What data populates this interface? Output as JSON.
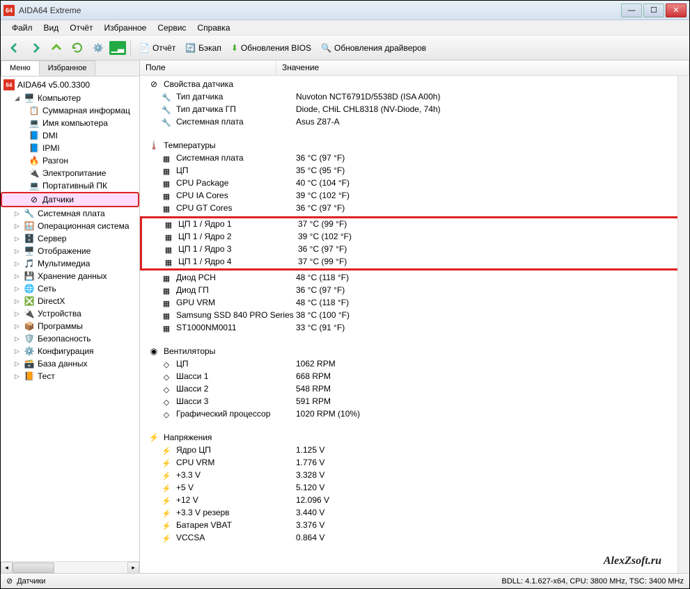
{
  "window": {
    "title": "AIDA64 Extreme"
  },
  "menu": [
    "Файл",
    "Вид",
    "Отчёт",
    "Избранное",
    "Сервис",
    "Справка"
  ],
  "toolbar": {
    "report": "Отчёт",
    "backup": "Бэкап",
    "bios_update": "Обновления BIOS",
    "driver_update": "Обновления драйверов"
  },
  "tabs": {
    "menu": "Меню",
    "fav": "Избранное"
  },
  "tree": {
    "root": "AIDA64 v5.00.3300",
    "computer": "Компьютер",
    "computer_children": [
      "Суммарная информац",
      "Имя компьютера",
      "DMI",
      "IPMI",
      "Разгон",
      "Электропитание",
      "Портативный ПК",
      "Датчики"
    ],
    "siblings": [
      "Системная плата",
      "Операционная система",
      "Сервер",
      "Отображение",
      "Мультимедиа",
      "Хранение данных",
      "Сеть",
      "DirectX",
      "Устройства",
      "Программы",
      "Безопасность",
      "Конфигурация",
      "База данных",
      "Тест"
    ]
  },
  "columns": {
    "field": "Поле",
    "value": "Значение"
  },
  "sections": {
    "sensor_props": {
      "title": "Свойства датчика",
      "rows": [
        {
          "label": "Тип датчика",
          "value": "Nuvoton NCT6791D/5538D  (ISA A00h)"
        },
        {
          "label": "Тип датчика ГП",
          "value": "Diode, CHiL CHL8318  (NV-Diode, 74h)"
        },
        {
          "label": "Системная плата",
          "value": "Asus Z87-A"
        }
      ]
    },
    "temps": {
      "title": "Температуры",
      "rows_top": [
        {
          "label": "Системная плата",
          "value": "36 °C  (97 °F)"
        },
        {
          "label": "ЦП",
          "value": "35 °C  (95 °F)"
        },
        {
          "label": "CPU Package",
          "value": "40 °C  (104 °F)"
        },
        {
          "label": "CPU IA Cores",
          "value": "39 °C  (102 °F)"
        },
        {
          "label": "CPU GT Cores",
          "value": "36 °C  (97 °F)"
        }
      ],
      "rows_hl": [
        {
          "label": "ЦП 1 / Ядро 1",
          "value": "37 °C  (99 °F)"
        },
        {
          "label": "ЦП 1 / Ядро 2",
          "value": "39 °C  (102 °F)"
        },
        {
          "label": "ЦП 1 / Ядро 3",
          "value": "36 °C  (97 °F)"
        },
        {
          "label": "ЦП 1 / Ядро 4",
          "value": "37 °C  (99 °F)"
        }
      ],
      "rows_bot": [
        {
          "label": "Диод PCH",
          "value": "48 °C  (118 °F)"
        },
        {
          "label": "Диод ГП",
          "value": "36 °C  (97 °F)"
        },
        {
          "label": "GPU VRM",
          "value": "48 °C  (118 °F)"
        },
        {
          "label": "Samsung SSD 840 PRO Series",
          "value": "38 °C  (100 °F)"
        },
        {
          "label": "ST1000NM0011",
          "value": "33 °C  (91 °F)"
        }
      ]
    },
    "fans": {
      "title": "Вентиляторы",
      "rows": [
        {
          "label": "ЦП",
          "value": "1062 RPM"
        },
        {
          "label": "Шасси 1",
          "value": "668 RPM"
        },
        {
          "label": "Шасси 2",
          "value": "548 RPM"
        },
        {
          "label": "Шасси 3",
          "value": "591 RPM"
        },
        {
          "label": "Графический процессор",
          "value": "1020 RPM  (10%)"
        }
      ]
    },
    "volts": {
      "title": "Напряжения",
      "rows": [
        {
          "label": "Ядро ЦП",
          "value": "1.125 V"
        },
        {
          "label": "CPU VRM",
          "value": "1.776 V"
        },
        {
          "label": "+3.3 V",
          "value": "3.328 V"
        },
        {
          "label": "+5 V",
          "value": "5.120 V"
        },
        {
          "label": "+12 V",
          "value": "12.096 V"
        },
        {
          "label": "+3.3 V резерв",
          "value": "3.440 V"
        },
        {
          "label": "Батарея VBAT",
          "value": "3.376 V"
        },
        {
          "label": "VCCSA",
          "value": "0.864 V"
        }
      ]
    }
  },
  "statusbar": {
    "left": "Датчики",
    "right": "BDLL: 4.1.627-x64, CPU: 3800 MHz, TSC: 3400 MHz"
  },
  "watermark": "AlexZsoft.ru",
  "tree_icons": [
    "🖥️",
    "📋",
    "💻",
    "📘",
    "📘",
    "🔥",
    "🔌",
    "💻",
    "⊘"
  ],
  "sibling_icons": [
    "🔧",
    "🪟",
    "🗄️",
    "🖥️",
    "🎵",
    "💾",
    "🌐",
    "❎",
    "🔌",
    "📦",
    "🛡️",
    "⚙️",
    "🗃️",
    "📙"
  ]
}
